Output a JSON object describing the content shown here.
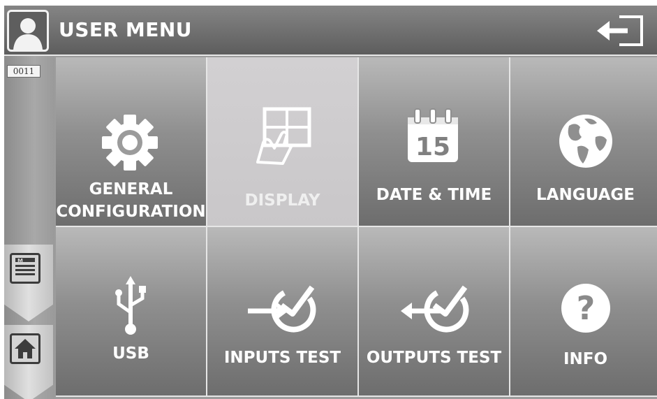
{
  "header": {
    "title": "USER MENU",
    "user_icon": "user-avatar-icon",
    "exit_icon": "logout-icon"
  },
  "sidebar": {
    "code": "0011",
    "items": [
      {
        "icon": "manual-menu-icon"
      },
      {
        "icon": "home-icon"
      }
    ]
  },
  "tiles": [
    {
      "id": "general",
      "label_line1": "GENERAL",
      "label_line2": "CONFIGURATION",
      "icon": "gear-icon"
    },
    {
      "id": "display",
      "label": "DISPLAY",
      "icon": "touch-screen-icon",
      "selected": true
    },
    {
      "id": "datetime",
      "label": "DATE & TIME",
      "icon": "calendar-icon",
      "calendar_day": "15"
    },
    {
      "id": "language",
      "label": "LANGUAGE",
      "icon": "globe-icon"
    },
    {
      "id": "usb",
      "label": "USB",
      "icon": "usb-icon"
    },
    {
      "id": "inputs",
      "label": "INPUTS TEST",
      "icon": "input-test-icon"
    },
    {
      "id": "outputs",
      "label": "OUTPUTS TEST",
      "icon": "output-test-icon"
    },
    {
      "id": "info",
      "label": "INFO",
      "icon": "help-icon",
      "symbol": "?"
    }
  ],
  "colors": {
    "header": "#6f6f6f",
    "tile_active": "#cdcbcd",
    "text": "#ffffff"
  }
}
